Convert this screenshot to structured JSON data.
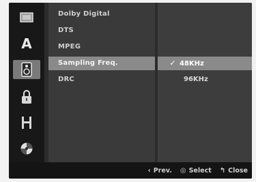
{
  "sidebar": {
    "icons": [
      {
        "name": "display-icon",
        "active": false
      },
      {
        "name": "language-icon",
        "glyph": "A",
        "active": false
      },
      {
        "name": "audio-speaker-icon",
        "active": true
      },
      {
        "name": "lock-icon",
        "active": false
      },
      {
        "name": "recording-film-icon",
        "active": false
      },
      {
        "name": "disc-icon",
        "active": false
      }
    ]
  },
  "menu": {
    "items": [
      {
        "label": "Dolby Digital"
      },
      {
        "label": "DTS"
      },
      {
        "label": "MPEG"
      },
      {
        "label": "Sampling Freq."
      },
      {
        "label": "DRC"
      }
    ],
    "selected_index": 3
  },
  "options": {
    "items": [
      {
        "check": "✓",
        "label": "48KHz"
      },
      {
        "label": "96KHz"
      }
    ],
    "selected_index": 0
  },
  "footer": {
    "prev": {
      "glyph": "‹",
      "label": "Prev."
    },
    "select": {
      "glyph": "◎",
      "label": "Select"
    },
    "close": {
      "glyph": "↰",
      "label": "Close"
    }
  },
  "colors": {
    "highlight": "#8a8a8a",
    "menu_bg": "#3a3a3a",
    "options_bg": "#3d3d3d",
    "sidebar_bg": "#181818",
    "footer_bg": "#141414"
  }
}
